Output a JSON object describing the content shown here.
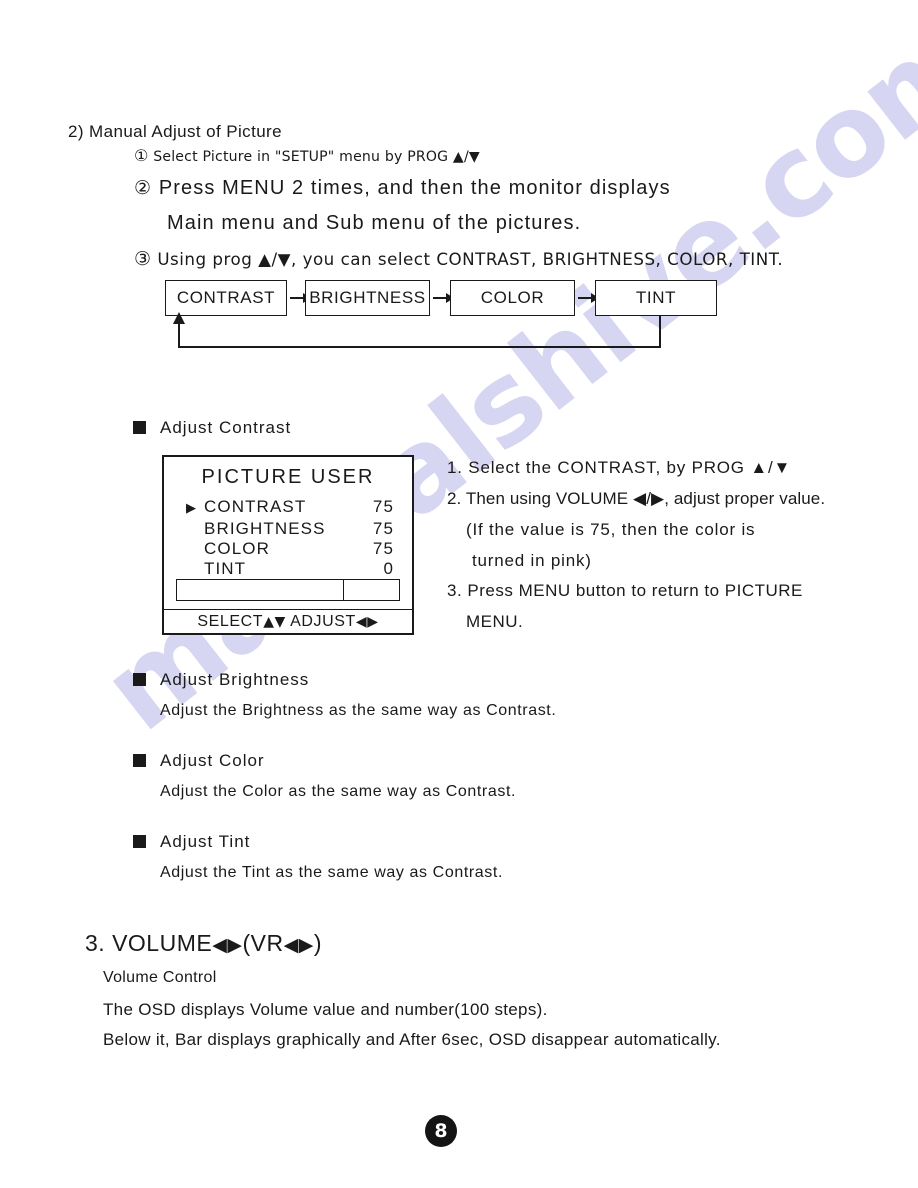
{
  "section": {
    "number_label": "2)",
    "title": "Manual Adjust of Picture",
    "steps": [
      {
        "marker": "①",
        "text": "Select Picture in \"SETUP\" menu by PROG ▲/▼"
      },
      {
        "marker": "②",
        "text": "Press MENU 2 times, and then the monitor displays"
      },
      {
        "marker": "",
        "text": "Main menu and Sub menu of the pictures."
      },
      {
        "marker": "③",
        "text": "Using prog ▲/▼, you can select CONTRAST, BRIGHTNESS, COLOR, TINT."
      }
    ]
  },
  "flowchart": {
    "boxes": [
      "CONTRAST",
      "BRIGHTNESS",
      "COLOR",
      "TINT"
    ],
    "loop_from": "TINT",
    "loop_to": "CONTRAST"
  },
  "adjust_contrast": {
    "bullet_label": "Adjust Contrast",
    "osd": {
      "title": "PICTURE USER",
      "cursor_glyph": "▶",
      "selected_index": 0,
      "rows": [
        {
          "label": "CONTRAST",
          "value": "75"
        },
        {
          "label": "BRIGHTNESS",
          "value": "75"
        },
        {
          "label": "COLOR",
          "value": "75"
        },
        {
          "label": "TINT",
          "value": "0"
        }
      ],
      "bar_fill_percent": 75,
      "footer": "SELECT▲▼ ADJUST◀▶",
      "footer_parts": {
        "select_label": "SELECT",
        "select_glyphs": "▲▼",
        "adjust_label": "ADJUST",
        "adjust_glyphs": "◀▶"
      }
    },
    "instructions": [
      "1. Select the CONTRAST, by PROG ▲/▼",
      "2. Then using VOLUME ◀/▶, adjust proper value.",
      "(If the value is 75, then the color is",
      "turned in pink)",
      "3. Press MENU button to return to PICTURE",
      "MENU."
    ]
  },
  "adjust_sections": [
    {
      "heading": "Adjust Brightness",
      "body": "Adjust the Brightness as the same way as Contrast."
    },
    {
      "heading": "Adjust Color",
      "body": "Adjust the Color as the same way as Contrast."
    },
    {
      "heading": "Adjust Tint",
      "body": "Adjust the Tint as the same way as Contrast."
    }
  ],
  "volume_section": {
    "number": "3.",
    "title_main": "VOLUME",
    "title_glyph1": "◀▶",
    "title_paren_open": "(VR",
    "title_glyph2": "◀▶",
    "title_paren_close": ")",
    "subtitle": "Volume Control",
    "lines": [
      "The OSD displays Volume value and number(100 steps).",
      "Below it, Bar displays graphically and After 6sec, OSD disappear automatically."
    ]
  },
  "page_number": "8",
  "watermark": {
    "text": "manualshive.com",
    "color": "#c9c9ee"
  }
}
